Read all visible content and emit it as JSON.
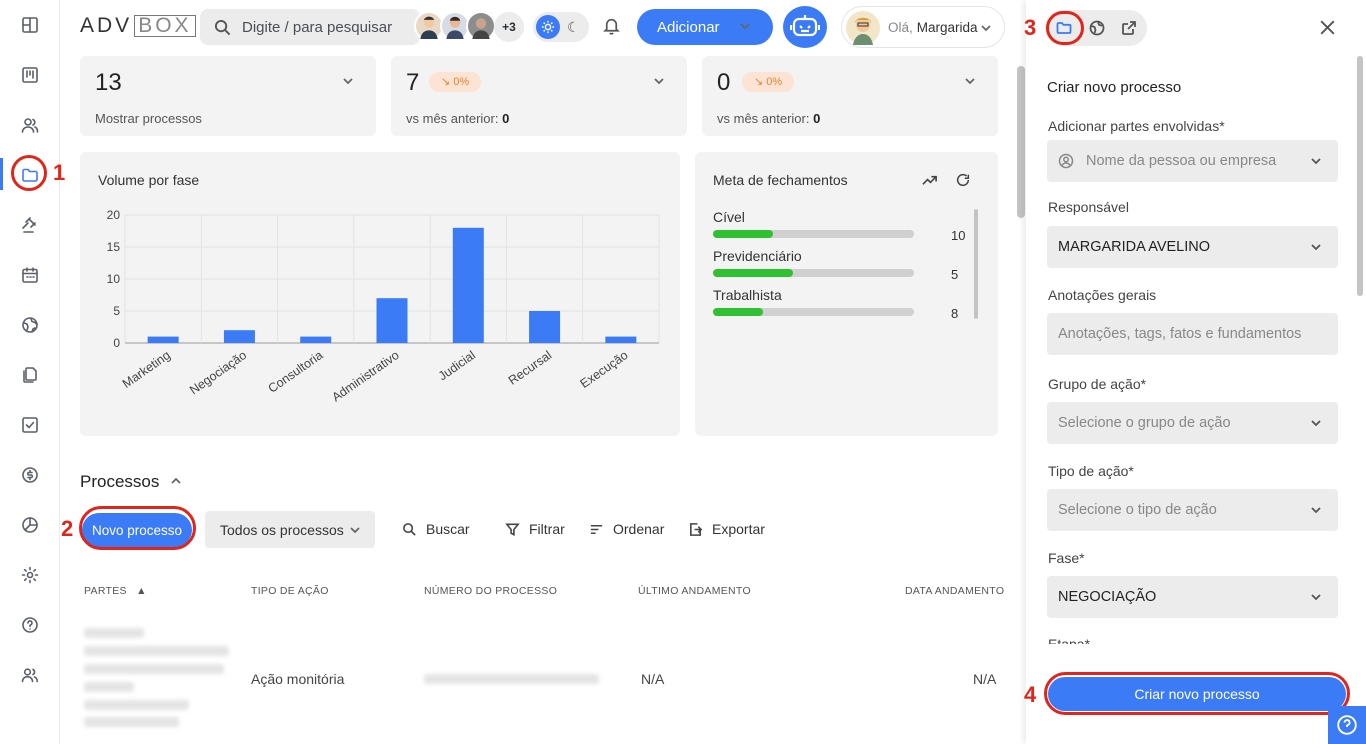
{
  "header": {
    "logo_left": "ADV",
    "logo_right": "BOX",
    "search_placeholder": "Digite / para pesquisar",
    "avatars_more": "+3",
    "add_label": "Adicionar",
    "greeting_prefix": "Olá,",
    "user_name": "Margarida"
  },
  "kpis": [
    {
      "value": "13",
      "subtitle": "Mostrar processos",
      "badge": ""
    },
    {
      "value": "7",
      "badge": "↘ 0%",
      "subtitle": "vs mês anterior:",
      "subvalue": "0"
    },
    {
      "value": "0",
      "badge": "↘ 0%",
      "subtitle": "vs mês anterior:",
      "subvalue": "0"
    }
  ],
  "chart_data": {
    "type": "bar",
    "title": "Volume por fase",
    "categories": [
      "Marketing",
      "Negociação",
      "Consultoria",
      "Administrativo",
      "Judicial",
      "Recursal",
      "Execução"
    ],
    "values": [
      1,
      2,
      1,
      7,
      18,
      5,
      1
    ],
    "ylim": [
      0,
      20
    ],
    "yticks": [
      0,
      5,
      10,
      15,
      20
    ],
    "grid": true,
    "color": "#3b7bf5"
  },
  "meta": {
    "title": "Meta de fechamentos",
    "rows": [
      {
        "label": "Cível",
        "value": "10",
        "progress": 0.3
      },
      {
        "label": "Previdenciário",
        "value": "5",
        "progress": 0.4
      },
      {
        "label": "Trabalhista",
        "value": "8",
        "progress": 0.25
      }
    ]
  },
  "processos": {
    "title": "Processos",
    "new_button": "Novo processo",
    "filter_select": "Todos os processos",
    "tools": {
      "search": "Buscar",
      "filter": "Filtrar",
      "order": "Ordenar",
      "export": "Exportar"
    },
    "columns": [
      "PARTES",
      "TIPO DE AÇÃO",
      "NÚMERO DO PROCESSO",
      "ÚLTIMO ANDAMENTO",
      "DATA ANDAMENTO"
    ],
    "sort_indicator": "▲",
    "rows": [
      {
        "tipo": "Ação monitória",
        "ultimo": "N/A",
        "data": "N/A"
      }
    ]
  },
  "annotations": {
    "step1": "1",
    "step2": "2",
    "step3": "3",
    "step4": "4"
  },
  "panel": {
    "form_title": "Criar novo processo",
    "fields": [
      {
        "label": "Adicionar partes envolvidas*",
        "placeholder": "Nome da pessoa ou empresa",
        "value": ""
      },
      {
        "label": "Responsável",
        "placeholder": "",
        "value": "MARGARIDA AVELINO"
      },
      {
        "label": "Anotações gerais",
        "placeholder": "Anotações, tags, fatos e fundamentos",
        "value": ""
      },
      {
        "label": "Grupo de ação*",
        "placeholder": "Selecione o grupo de ação",
        "value": ""
      },
      {
        "label": "Tipo de ação*",
        "placeholder": "Selecione o tipo de ação",
        "value": ""
      },
      {
        "label": "Fase*",
        "placeholder": "",
        "value": "NEGOCIAÇÃO"
      }
    ],
    "next_label": "Etapa*",
    "submit": "Criar novo processo"
  },
  "colors": {
    "accent": "#3b7bf5",
    "annotation": "#e0251b",
    "progress": "#2fc131"
  }
}
